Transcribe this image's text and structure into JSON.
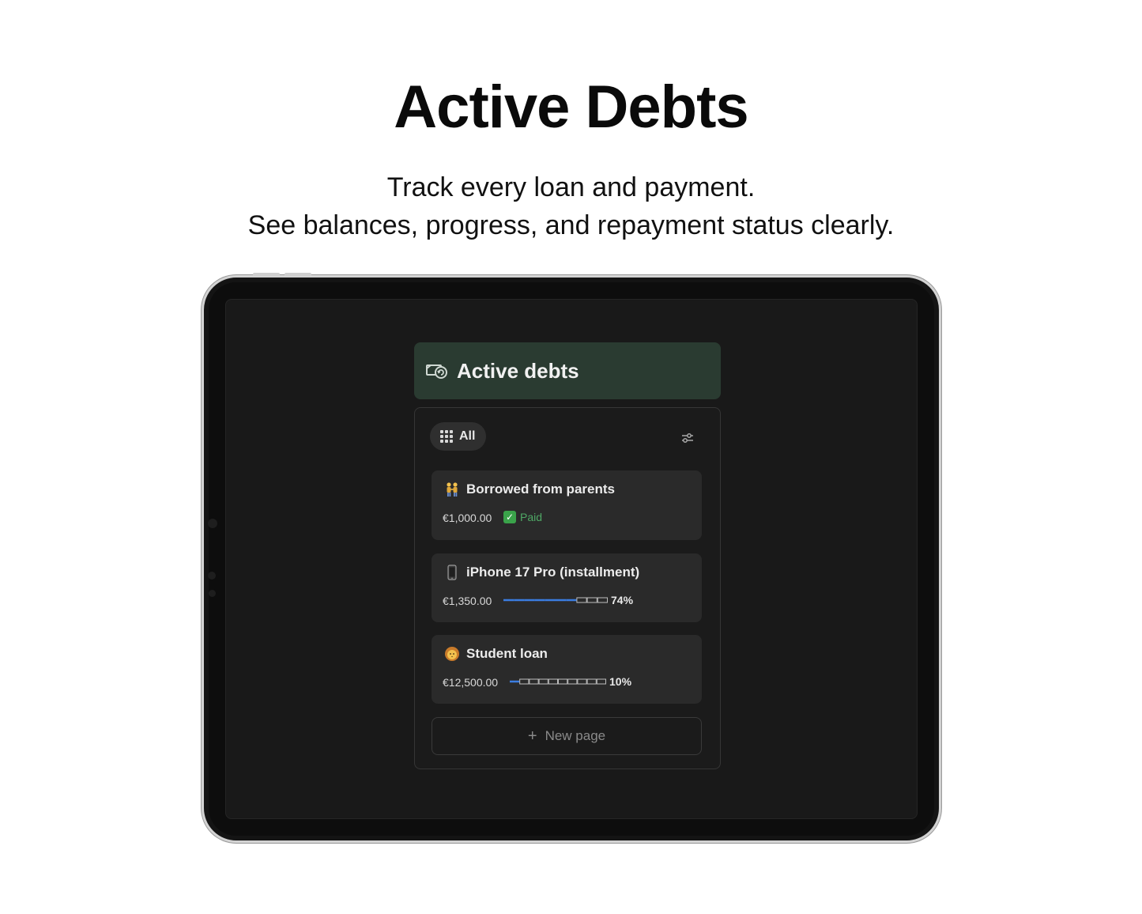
{
  "hero": {
    "title": "Active Debts",
    "subtitle_line1": "Track every loan and payment.",
    "subtitle_line2": "See balances, progress, and repayment status clearly."
  },
  "app": {
    "header_title": "Active debts",
    "header_icon": "money-return-icon",
    "view_label": "All",
    "new_page_label": "New page",
    "accent_header": "#2a3b31",
    "progress_color": "#3b7de0"
  },
  "debts": [
    {
      "emoji": "people-holding-hands",
      "title": "Borrowed from parents",
      "amount": "€1,000.00",
      "status": "Paid"
    },
    {
      "emoji": "mobile-phone",
      "title": "iPhone 17 Pro (installment)",
      "amount": "€1,350.00",
      "progress_label": "74%",
      "progress": 0.74
    },
    {
      "emoji": "lion-face",
      "title": "Student loan",
      "amount": "€12,500.00",
      "progress_label": "10%",
      "progress": 0.1
    }
  ]
}
